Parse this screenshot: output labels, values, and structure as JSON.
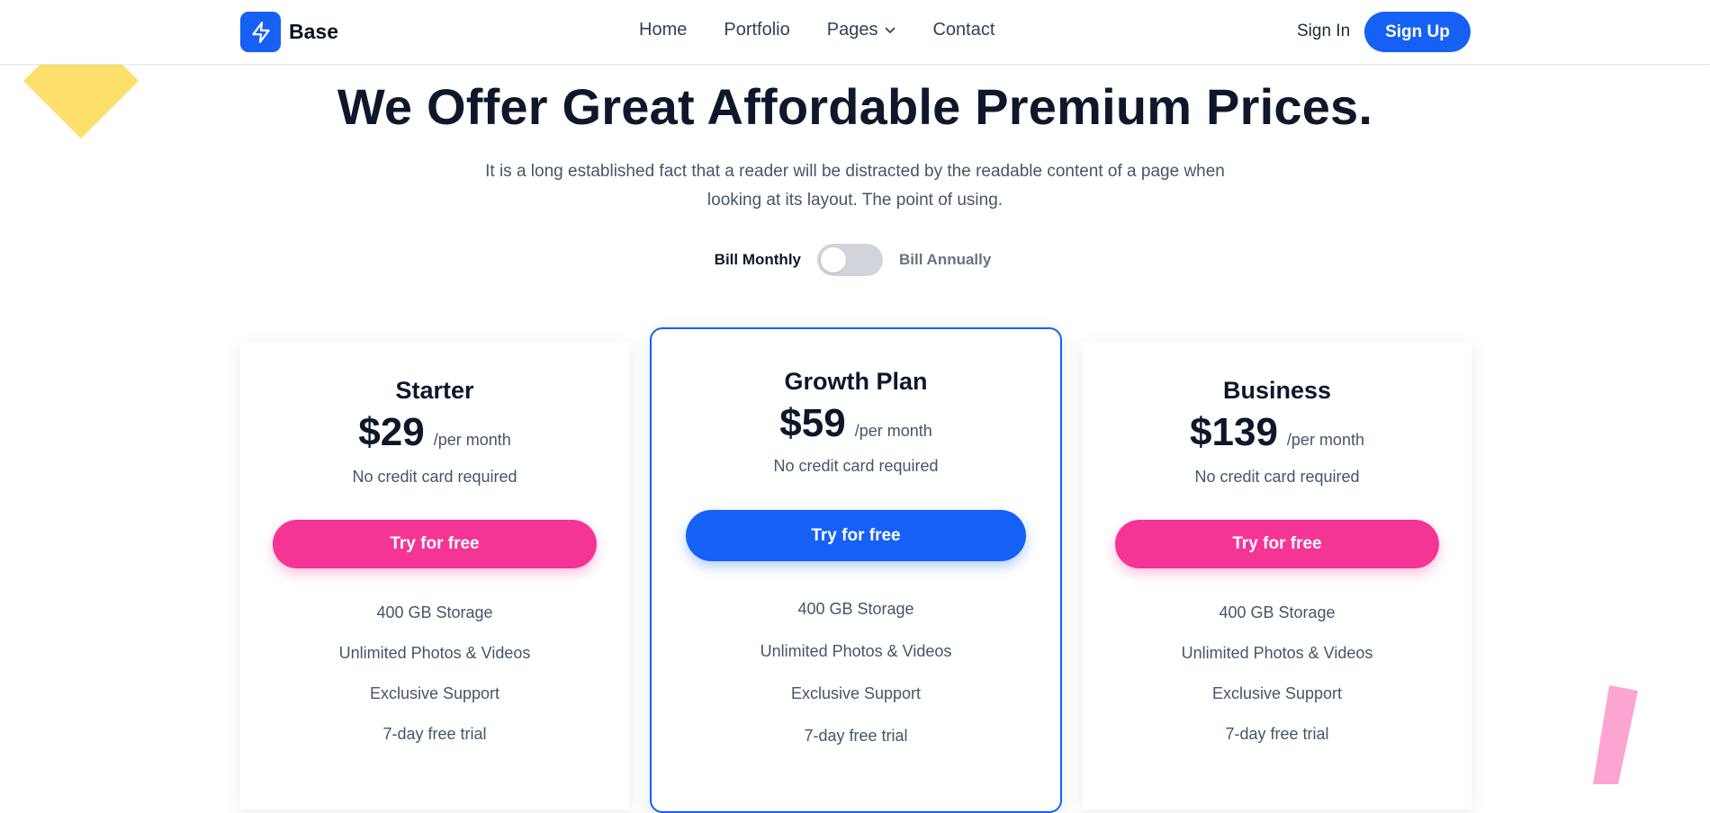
{
  "header": {
    "logo_icon": "lightning-bolt-icon",
    "brand": "Base",
    "nav": [
      {
        "label": "Home"
      },
      {
        "label": "Portfolio"
      },
      {
        "label": "Pages",
        "icon": "chevron-down-icon"
      },
      {
        "label": "Contact"
      }
    ],
    "sign_in": "Sign In",
    "sign_up": "Sign Up"
  },
  "hero": {
    "title": "We Offer Great Affordable Premium Prices.",
    "subtitle": "It is a long established fact that a reader will be distracted by the readable content of a page when looking at its layout. The point of using."
  },
  "billing": {
    "monthly_label": "Bill Monthly",
    "annual_label": "Bill Annually",
    "annual_selected": false
  },
  "plans": [
    {
      "name": "Starter",
      "price": "$29",
      "period": "/per month",
      "note": "No credit card required",
      "cta": "Try for free",
      "features": [
        "400 GB Storage",
        "Unlimited Photos & Videos",
        "Exclusive Support",
        "7-day free trial"
      ]
    },
    {
      "name": "Growth Plan",
      "price": "$59",
      "period": "/per month",
      "note": "No credit card required",
      "cta": "Try for free",
      "features": [
        "400 GB Storage",
        "Unlimited Photos & Videos",
        "Exclusive Support",
        "7-day free trial"
      ]
    },
    {
      "name": "Business",
      "price": "$139",
      "period": "/per month",
      "note": "No credit card required",
      "cta": "Try for free",
      "features": [
        "400 GB Storage",
        "Unlimited Photos & Videos",
        "Exclusive Support",
        "7-day free trial"
      ]
    }
  ],
  "colors": {
    "primary": "#1660f5",
    "accent_pink": "#f43596",
    "deco_yellow": "#fde06b",
    "deco_pink": "#fca5d0",
    "heading": "#0f172a",
    "body_text": "#475569"
  }
}
